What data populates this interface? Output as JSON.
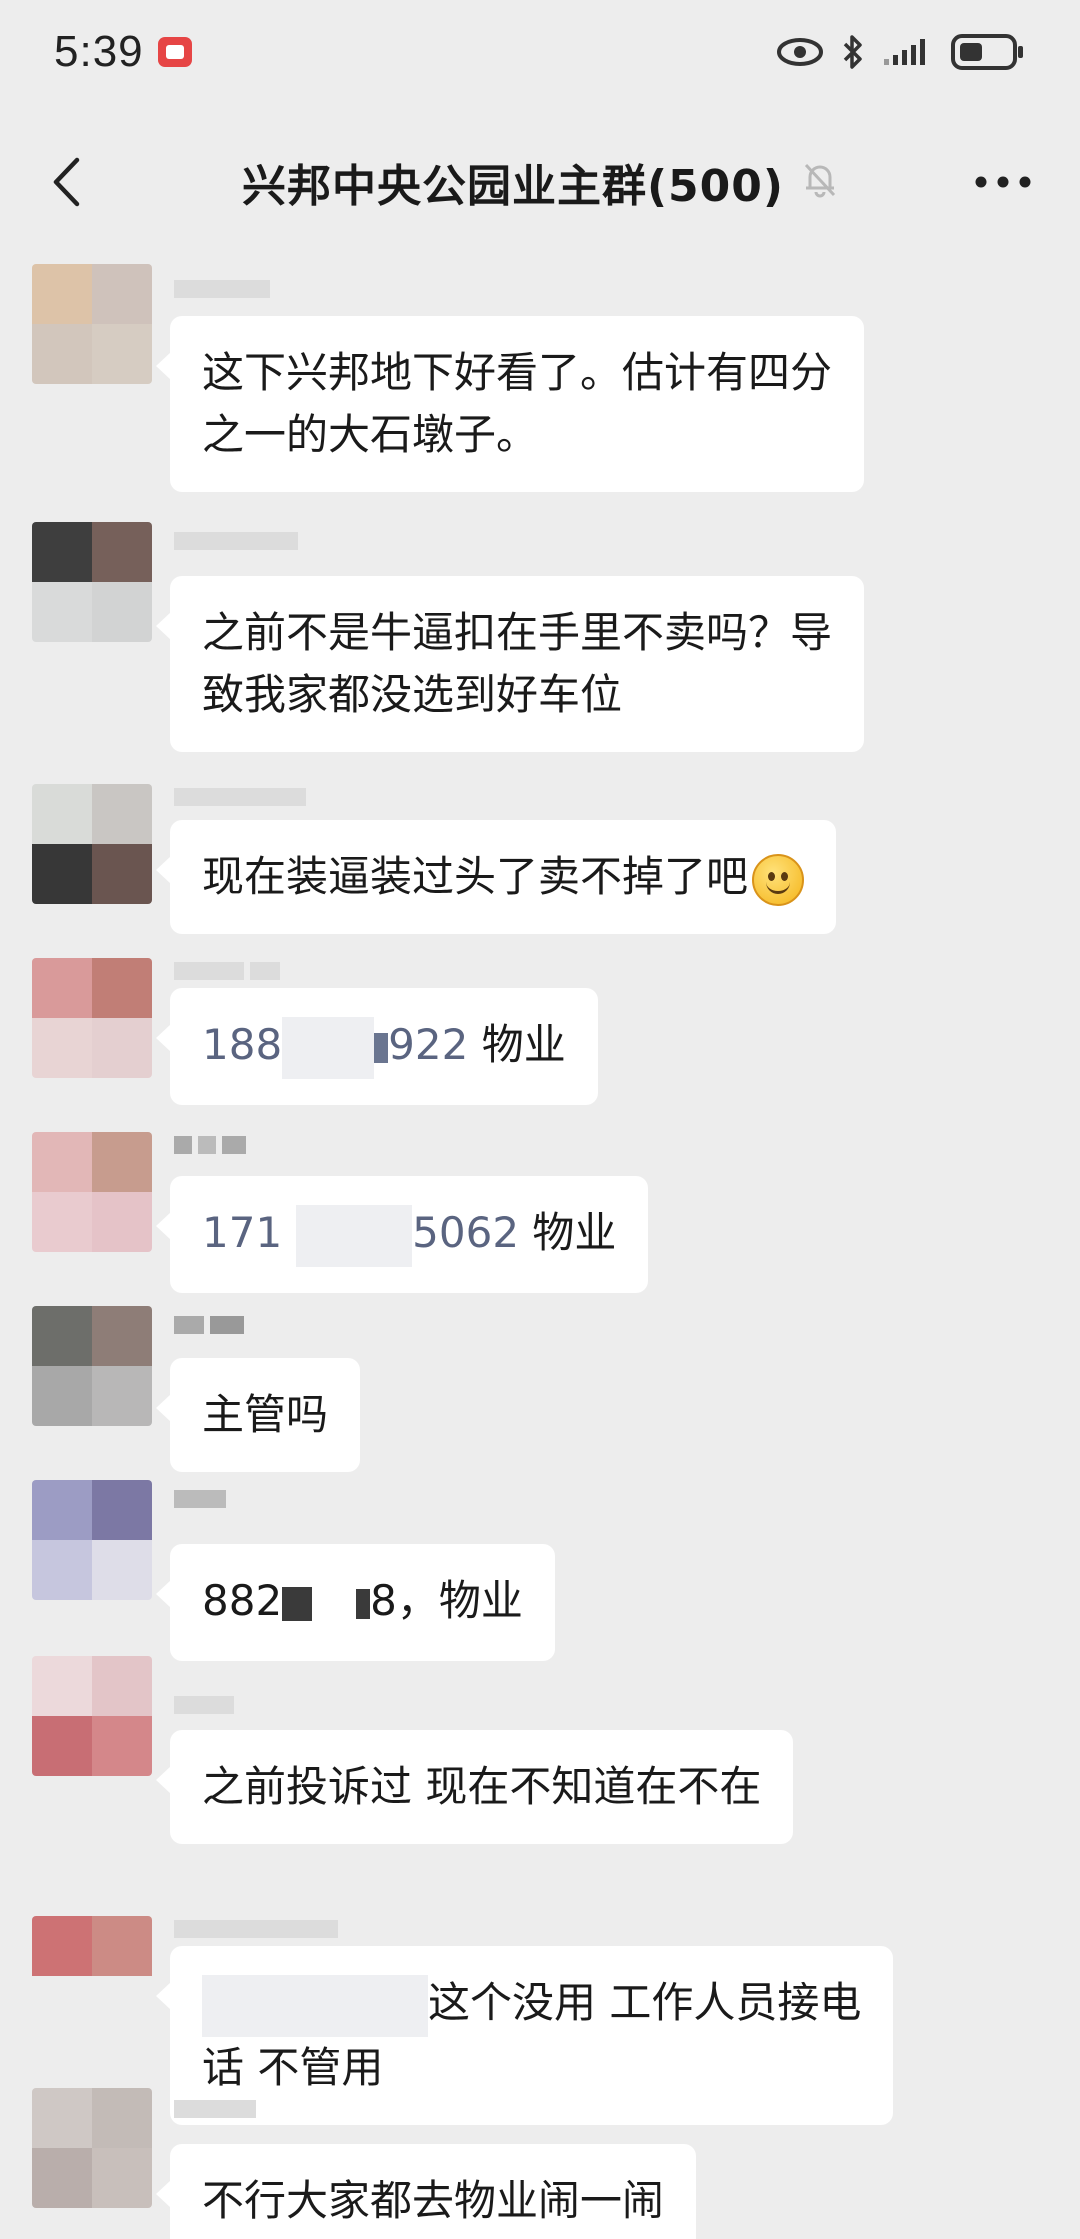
{
  "status_bar": {
    "time": "5:39",
    "icons": [
      "notification-app-icon",
      "eye-icon",
      "bluetooth-icon",
      "signal-icon",
      "battery-icon"
    ]
  },
  "header": {
    "title": "兴邦中央公园业主群(500)",
    "muted_icon": "bell-muted-icon",
    "back_icon": "back-arrow-icon",
    "more_icon": "more-icon"
  },
  "messages": [
    {
      "lines": [
        "这下兴邦地下好看了。估计有四分",
        "之一的大石墩子。"
      ]
    },
    {
      "lines": [
        "之前不是牛逼扣在手里不卖吗？导",
        "致我家都没选到好车位"
      ]
    },
    {
      "text": "现在装逼装过头了卖不掉了吧",
      "emoji": "smile-emoji"
    },
    {
      "phone_start": "188",
      "phone_end": "922",
      "suffix": " 物业"
    },
    {
      "phone_start": "171",
      "phone_end": "5062",
      "suffix": " 物业"
    },
    {
      "text": "主管吗"
    },
    {
      "phone_start": "882",
      "phone_end": "8，",
      "suffix": "物业"
    },
    {
      "text": "之前投诉过  现在不知道在不在"
    },
    {
      "line1": "这个没用 工作人员接电",
      "line2": "话 不管用"
    },
    {
      "text": "不行大家都去物业闹一闹"
    }
  ],
  "colors": {
    "background": "#ededed",
    "bubble": "#ffffff",
    "phone_text": "#5a6480"
  }
}
